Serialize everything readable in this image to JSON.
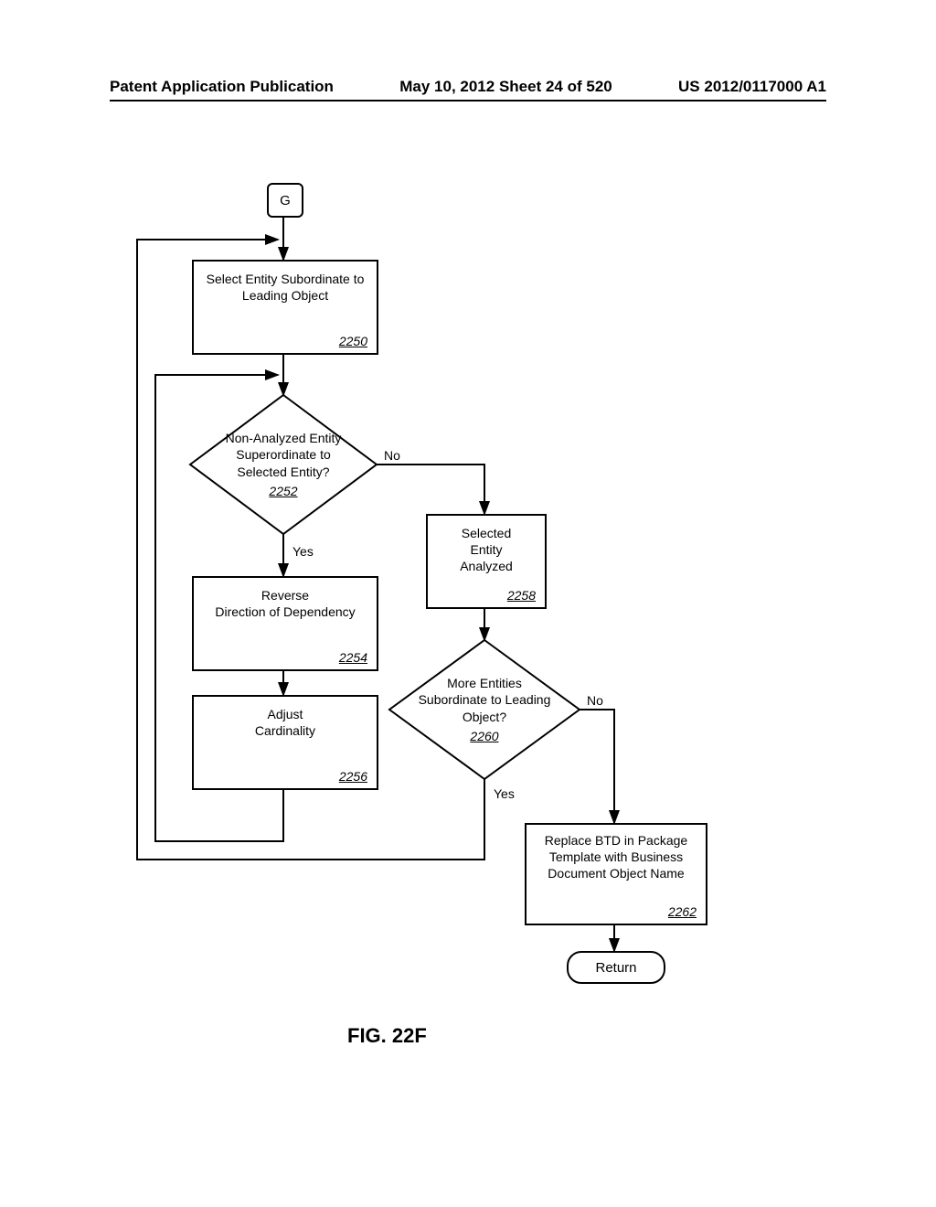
{
  "header": {
    "left": "Patent Application Publication",
    "center": "May 10, 2012  Sheet 24 of 520",
    "right": "US 2012/0117000 A1"
  },
  "nodes": {
    "start": "G",
    "n2250": {
      "text": "Select Entity Subordinate to\nLeading Object",
      "ref": "2250"
    },
    "n2252": {
      "text": "Non-Analyzed Entity\nSuperordinate to\nSelected Entity?",
      "ref": "2252"
    },
    "n2254": {
      "text": "Reverse\nDirection of Dependency",
      "ref": "2254"
    },
    "n2256": {
      "text": "Adjust\nCardinality",
      "ref": "2256"
    },
    "n2258": {
      "text": "Selected\nEntity\nAnalyzed",
      "ref": "2258"
    },
    "n2260": {
      "text": "More Entities\nSubordinate to Leading\nObject?",
      "ref": "2260"
    },
    "n2262": {
      "text": "Replace BTD in Package\nTemplate with Business\nDocument Object Name",
      "ref": "2262"
    },
    "end": "Return"
  },
  "labels": {
    "yes": "Yes",
    "no": "No"
  },
  "figure": "FIG. 22F"
}
